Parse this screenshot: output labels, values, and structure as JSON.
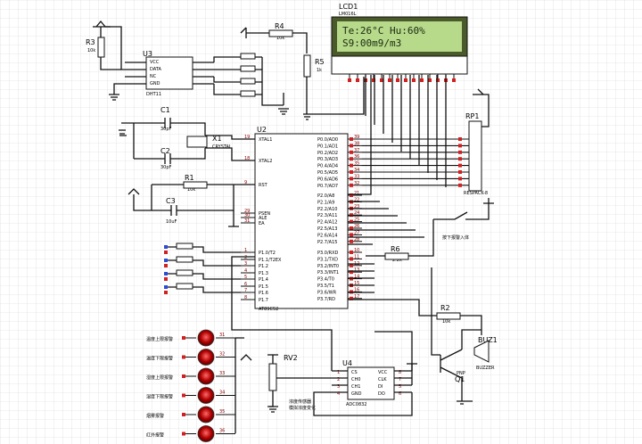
{
  "lcd": {
    "ref": "LCD1",
    "part": "LM016L",
    "line1": "Te:26°C  Hu:60%",
    "line2": "S9:00m9/m3",
    "bg": "#b7d98a"
  },
  "mcu": {
    "ref": "U2",
    "part": "AT89C52",
    "left_pins": [
      "XTAL1",
      "XTAL2",
      "RST",
      "PSEN",
      "ALE",
      "EA",
      "P1.0/T2",
      "P1.1/T2EX",
      "P1.2",
      "P1.3",
      "P1.4",
      "P1.5",
      "P1.6",
      "P1.7"
    ],
    "left_nums": [
      "19",
      "18",
      "9",
      "29",
      "30",
      "31",
      "1",
      "2",
      "3",
      "4",
      "5",
      "6",
      "7",
      "8"
    ],
    "right_p0": [
      "P0.0/AD0",
      "P0.1/AD1",
      "P0.2/AD2",
      "P0.3/AD3",
      "P0.4/AD4",
      "P0.5/AD5",
      "P0.6/AD6",
      "P0.7/AD7"
    ],
    "right_p0_nums": [
      "39",
      "38",
      "37",
      "36",
      "35",
      "34",
      "33",
      "32"
    ],
    "right_p2": [
      "P2.0/A8",
      "P2.1/A9",
      "P2.2/A10",
      "P2.3/A11",
      "P2.4/A12",
      "P2.5/A13",
      "P2.6/A14",
      "P2.7/A15"
    ],
    "right_p2_nums": [
      "21",
      "22",
      "23",
      "24",
      "25",
      "26",
      "27",
      "28"
    ],
    "right_p3": [
      "P3.0/RXD",
      "P3.1/TXD",
      "P3.2/INT0",
      "P3.3/INT1",
      "P3.4/T0",
      "P3.5/T1",
      "P3.6/WR",
      "P3.7/RD"
    ],
    "right_p3_nums": [
      "10",
      "11",
      "12",
      "13",
      "14",
      "15",
      "16",
      "17"
    ]
  },
  "dht": {
    "ref": "U3",
    "part": "DHT11",
    "pins": [
      "VCC",
      "DATA",
      "NC",
      "GND"
    ]
  },
  "adc": {
    "ref": "U4",
    "part": "ADC0832",
    "left": [
      "CS",
      "CH0",
      "CH1",
      "GND"
    ],
    "right": [
      "VCC",
      "CLK",
      "DI",
      "DO"
    ],
    "lnums": [
      "1",
      "2",
      "3",
      "4"
    ],
    "rnums": [
      "8",
      "7",
      "5",
      "6"
    ]
  },
  "rp": {
    "ref": "RP1",
    "part": "RESPACK-8"
  },
  "r1": {
    "ref": "R1",
    "val": "10k"
  },
  "r2": {
    "ref": "R2",
    "val": "10k"
  },
  "r3": {
    "ref": "R3",
    "val": "10k"
  },
  "r4": {
    "ref": "R4",
    "val": "10k"
  },
  "r5": {
    "ref": "R5",
    "val": "1k"
  },
  "r6": {
    "ref": "R6",
    "val": "2.2k"
  },
  "c1": {
    "ref": "C1",
    "val": "30pF"
  },
  "c2": {
    "ref": "C2",
    "val": "30pF"
  },
  "c3": {
    "ref": "C3",
    "val": "10uF"
  },
  "x1": {
    "ref": "X1",
    "part": "CRYSTAL"
  },
  "rv2": {
    "ref": "RV2"
  },
  "q1": {
    "ref": "Q1",
    "part": "PNP"
  },
  "buz": {
    "ref": "BUZ1",
    "part": "BUZZER"
  },
  "notes": {
    "switch": "按下报警入体",
    "pot": "浓度传感器\n模拟浓度变化"
  },
  "leds": [
    {
      "label": "温度上限报警",
      "pin": "31"
    },
    {
      "label": "温度下限报警",
      "pin": "32"
    },
    {
      "label": "湿度上限报警",
      "pin": "33"
    },
    {
      "label": "湿度下限报警",
      "pin": "34"
    },
    {
      "label": "烟雾报警",
      "pin": "35"
    },
    {
      "label": "红外报警",
      "pin": "36"
    }
  ]
}
